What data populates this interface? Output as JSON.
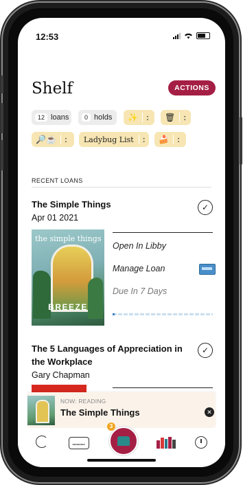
{
  "status": {
    "time": "12:53"
  },
  "header": {
    "title": "Shelf",
    "actions_label": "ACTIONS"
  },
  "filters": {
    "loans": {
      "count": "12",
      "label": "loans"
    },
    "holds": {
      "count": "0",
      "label": "holds"
    },
    "tag_list_label": "Ladybug List",
    "more_glyph": ":"
  },
  "recent_loans": {
    "section_label": "RECENT LOANS",
    "items": [
      {
        "title": "The Simple Things",
        "subtitle": "Apr 01 2021",
        "cover": {
          "masthead": "the simple things",
          "issue_word": "BREEZE"
        },
        "actions": [
          "Open In Libby",
          "Manage Loan",
          "Due In 7 Days"
        ],
        "progress": 0.02
      },
      {
        "title": "The 5 Languages of Appreciation in the Workplace",
        "subtitle": "Gary Chapman"
      }
    ]
  },
  "now_reading": {
    "eyebrow": "NOW: READING",
    "title": "The Simple Things"
  },
  "tabbar": {
    "badge": "3"
  },
  "colors": {
    "accent": "#a51f45",
    "chip_yellow": "#f7e6b3",
    "chip_gray": "#ececec",
    "progress": "#3d7ec2"
  }
}
